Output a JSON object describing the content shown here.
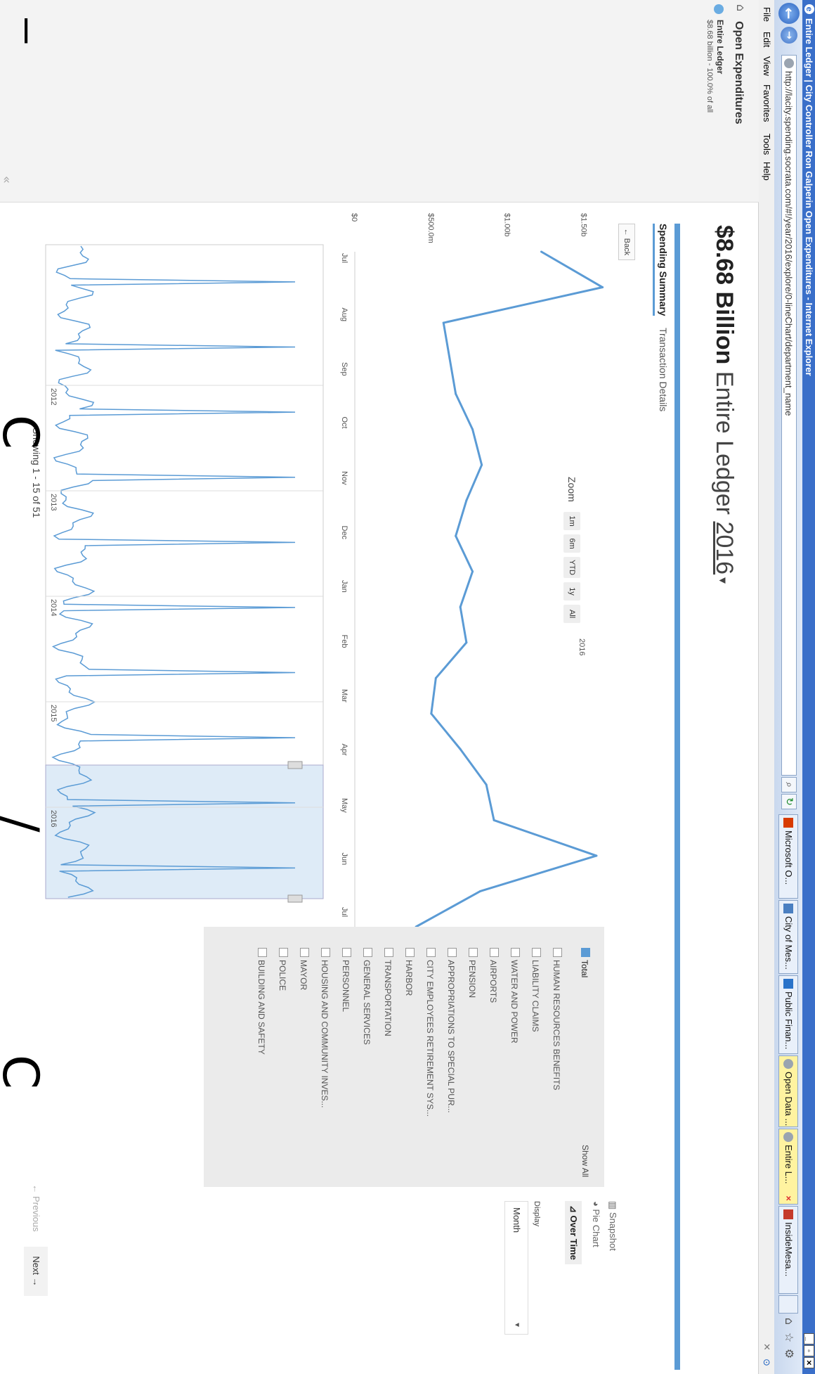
{
  "browser": {
    "window_title": "Entire Ledger | City Controller Ron Galperin Open Expenditures - Internet Explorer",
    "url": "http://lacity.spending.socrata.com/#!/year/2016/explore/0-lineChart/department_name",
    "tabs": [
      {
        "label": "Microsoft O..."
      },
      {
        "label": "City of Mes..."
      },
      {
        "label": "Public Finan..."
      },
      {
        "label": "Open Data ..."
      },
      {
        "label": "Entire L..."
      },
      {
        "label": "InsideMesa..."
      }
    ],
    "menu": [
      "File",
      "Edit",
      "View",
      "Favorites",
      "Tools",
      "Help"
    ]
  },
  "sidebar": {
    "title": "Open Expenditures",
    "ledger_name": "Entire Ledger",
    "ledger_amount": "$8.68 billion - 100.0% of all"
  },
  "header": {
    "amount": "$8.68 Billion",
    "ledger": "Entire Ledger",
    "year": "2016"
  },
  "view_tabs": [
    "Spending Summary",
    "Transaction Details"
  ],
  "back_label": "Back",
  "zoom": {
    "label": "Zoom",
    "buttons": [
      "1m",
      "6m",
      "YTD",
      "1y",
      "All"
    ]
  },
  "chart_data": {
    "type": "line",
    "y_ticks": [
      "$0",
      "$500.0m",
      "$1.00b",
      "$1.50b"
    ],
    "x": [
      "Jul",
      "Aug",
      "Sep",
      "Oct",
      "Nov",
      "Dec",
      "Jan",
      "Feb",
      "Mar",
      "Apr",
      "May",
      "Jun",
      "Jul"
    ],
    "series": [
      {
        "values": [
          1.22,
          1.62,
          0.58,
          0.62,
          0.66,
          0.77,
          0.83,
          0.73,
          0.66,
          0.77,
          0.69,
          0.73,
          0.53,
          0.5,
          0.69,
          0.86,
          0.91,
          1.58,
          0.82,
          0.4
        ]
      }
    ],
    "year_marker": "2016",
    "navigator_years": [
      "2012",
      "2013",
      "2014",
      "2015",
      "2016"
    ]
  },
  "legend": {
    "show_all": "Show All",
    "items": [
      "Total",
      "HUMAN RESOURCES BENEFITS",
      "LIABILITY CLAIMS",
      "WATER AND POWER",
      "AIRPORTS",
      "PENSION",
      "APPROPRIATIONS TO SPECIAL PUR...",
      "CITY EMPLOYEES RETIREMENT SYS...",
      "HARBOR",
      "TRANSPORTATION",
      "GENERAL SERVICES",
      "PERSONNEL",
      "HOUSING AND COMMUNITY INVES...",
      "MAYOR",
      "POLICE",
      "BUILDING AND SAFETY"
    ]
  },
  "views": {
    "snapshot": "Snapshot",
    "pie": "Pie Chart",
    "over_time": "Over Time",
    "display_label": "Display",
    "display_value": "Month"
  },
  "paging": {
    "showing": "Showing 1 - 15 of 51",
    "prev": "Previous",
    "next": "Next"
  },
  "colors": {
    "accent": "#5b9bd5",
    "ie_title": "#3a6fc9"
  }
}
